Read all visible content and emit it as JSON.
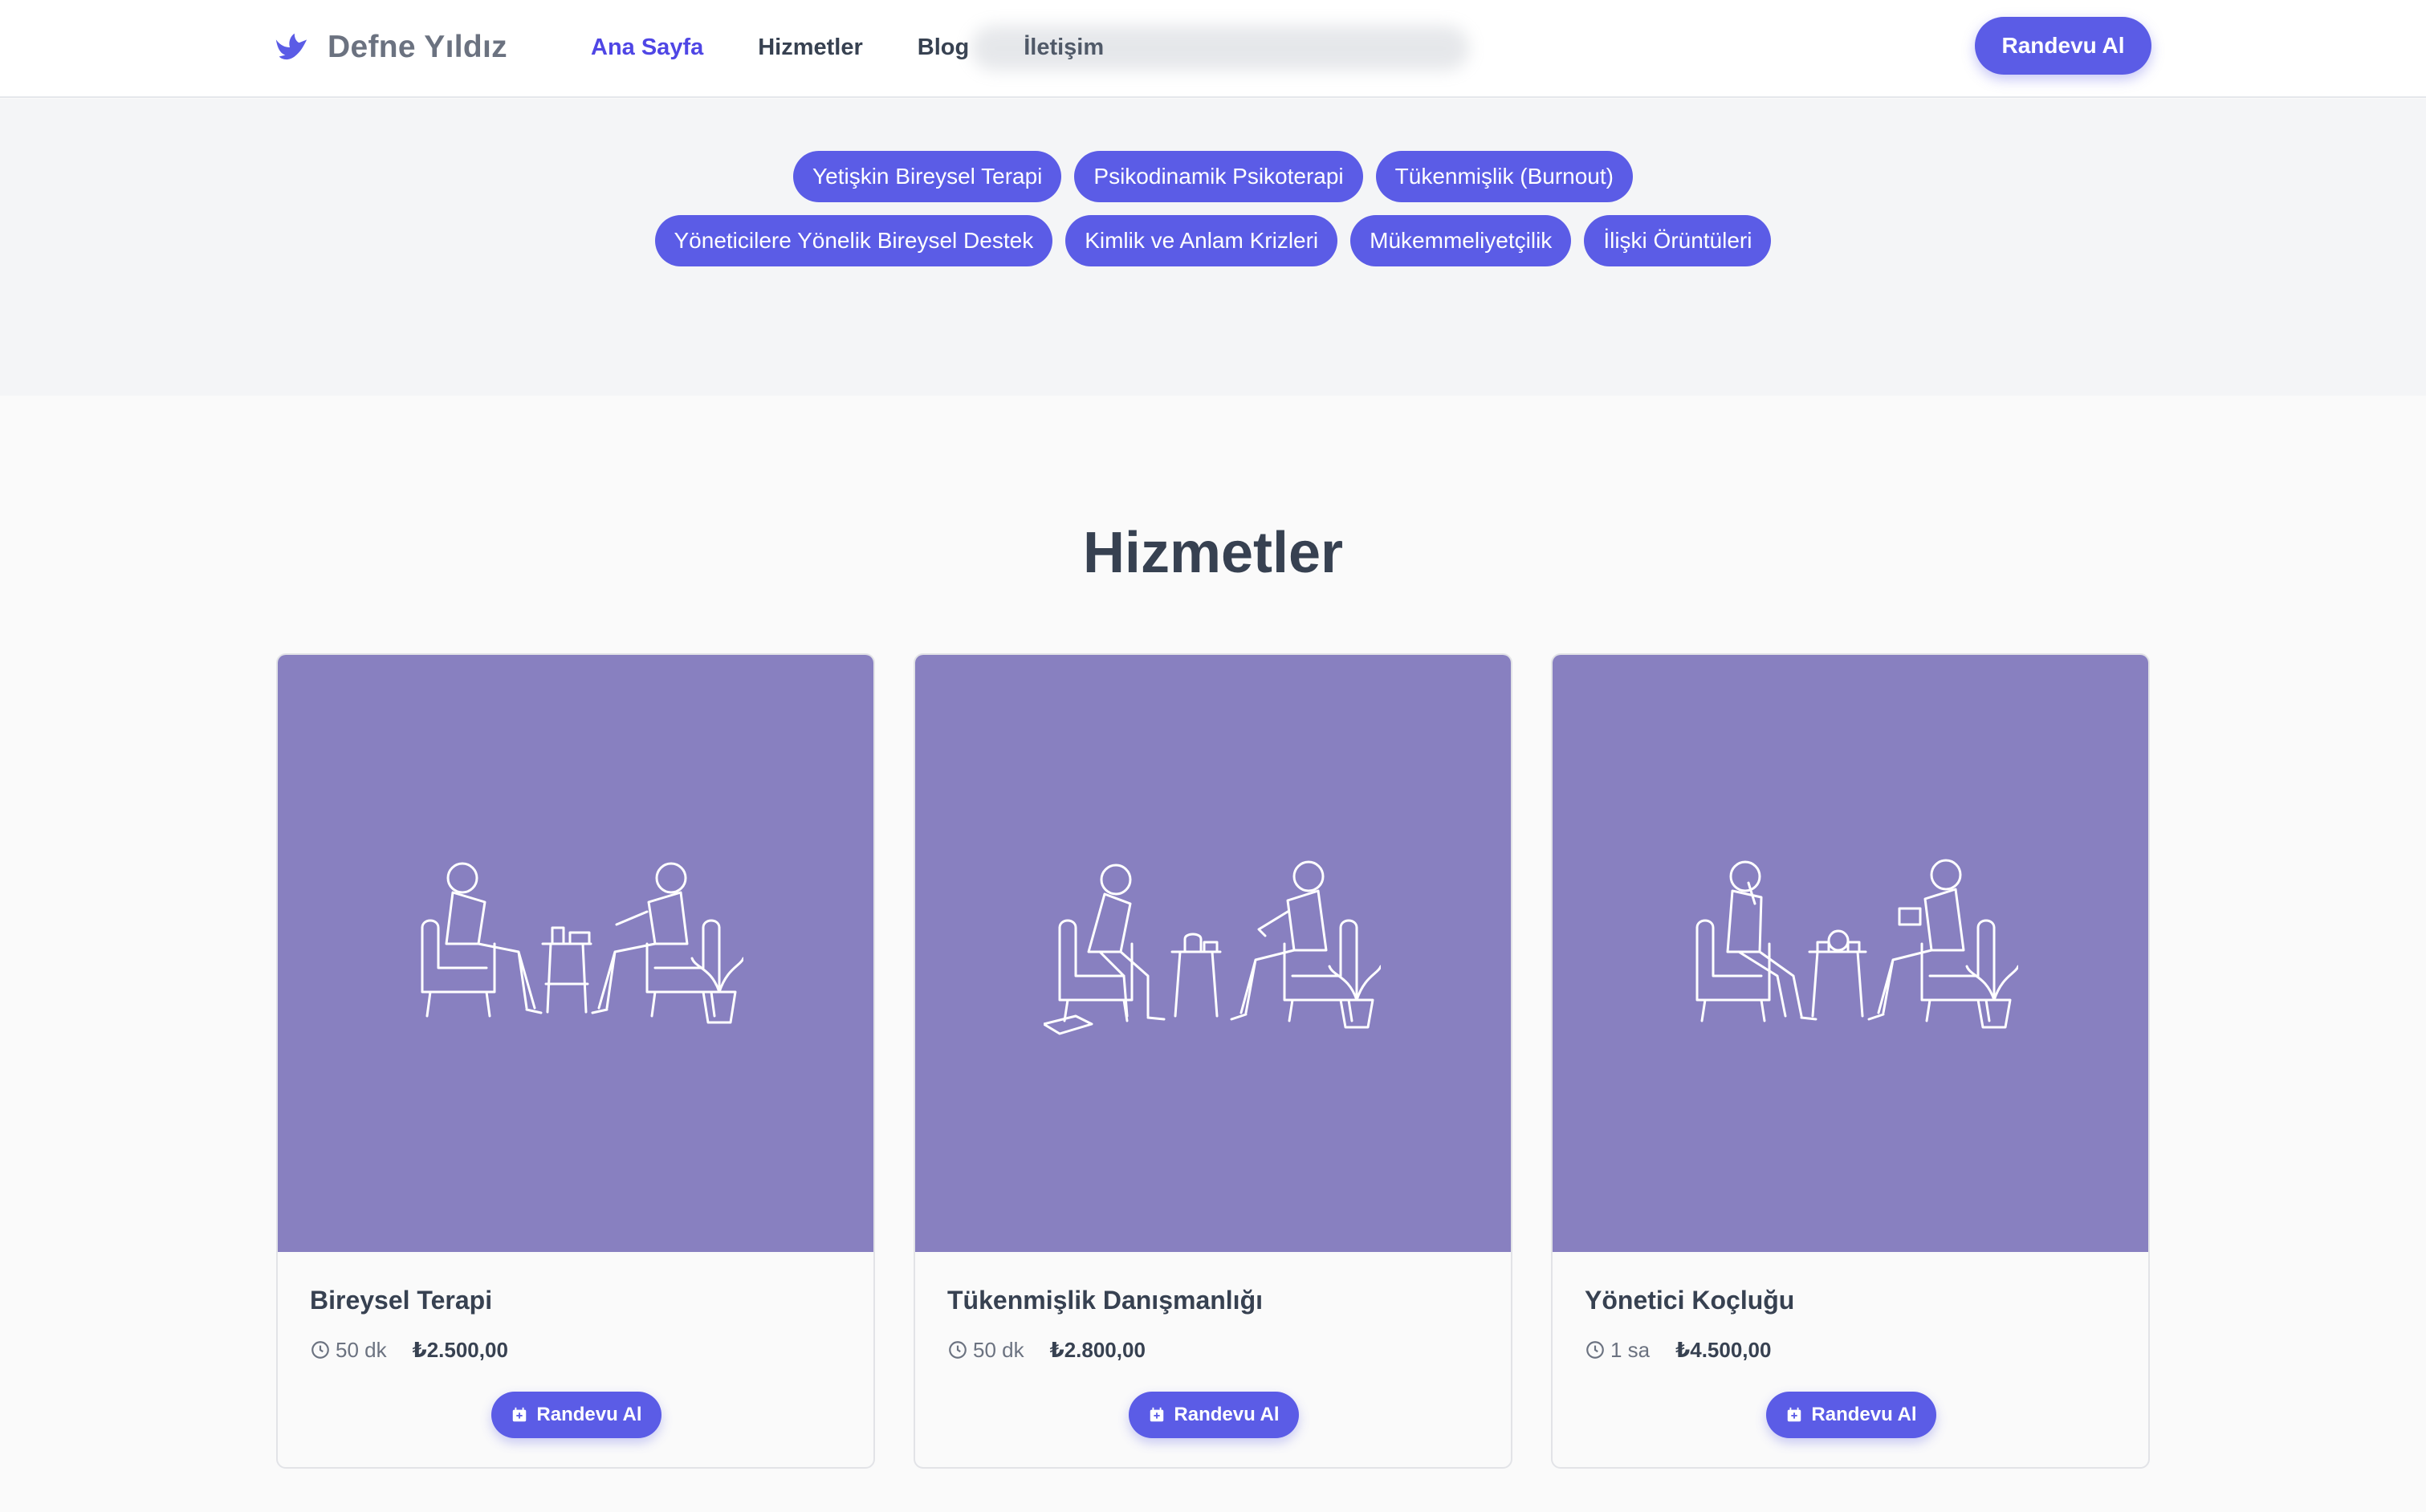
{
  "brand": {
    "name": "Defne Yıldız",
    "accent": "#5b5ce6",
    "icon": "dove-icon"
  },
  "nav": {
    "items": [
      {
        "label": "Ana Sayfa",
        "active": true
      },
      {
        "label": "Hizmetler",
        "active": false
      },
      {
        "label": "Blog",
        "active": false
      },
      {
        "label": "İletişim",
        "active": false
      }
    ],
    "cta_label": "Randevu Al"
  },
  "tags": {
    "row1": [
      "Yetişkin Bireysel Terapi",
      "Psikodinamik Psikoterapi",
      "Tükenmişlik (Burnout)"
    ],
    "row2": [
      "Yöneticilere Yönelik Bireysel Destek",
      "Kimlik ve Anlam Krizleri",
      "Mükemmeliyetçilik",
      "İlişki Örüntüleri"
    ]
  },
  "services": {
    "title": "Hizmetler",
    "cards": [
      {
        "title": "Bireysel Terapi",
        "duration": "50 dk",
        "price": "₺2.500,00",
        "button": "Randevu Al"
      },
      {
        "title": "Tükenmişlik Danışmanlığı",
        "duration": "50 dk",
        "price": "₺2.800,00",
        "button": "Randevu Al"
      },
      {
        "title": "Yönetici Koçluğu",
        "duration": "1 sa",
        "price": "₺4.500,00",
        "button": "Randevu Al"
      }
    ],
    "image_bg": "#8880c0"
  }
}
